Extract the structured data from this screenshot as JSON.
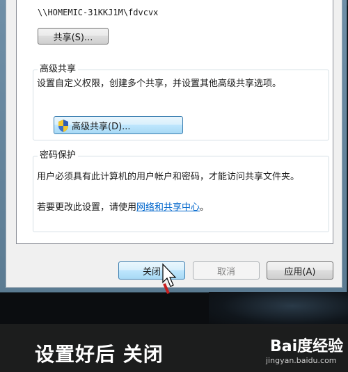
{
  "share": {
    "network_path": "\\\\HOMEMIC-31KKJ1M\\fdvcvx",
    "share_button": "共享(S)..."
  },
  "advanced_sharing": {
    "title": "高级共享",
    "description": "设置自定义权限，创建多个共享，并设置其他高级共享选项。",
    "button": "高级共享(D)..."
  },
  "password_protection": {
    "title": "密码保护",
    "description": "用户必须具有此计算机的用户帐户和密码，才能访问共享文件夹。",
    "change_prefix": "若要更改此设置，请使用",
    "link": "网络和共享中心",
    "change_suffix": "。"
  },
  "footer": {
    "close": "关闭",
    "cancel": "取消",
    "apply": "应用(A)"
  },
  "banner": {
    "caption": "设置好后 关闭",
    "logo": "Bai度经验",
    "url": "jingyan.baidu.com"
  },
  "icons": [
    "shield-icon",
    "mouse-cursor-icon"
  ]
}
